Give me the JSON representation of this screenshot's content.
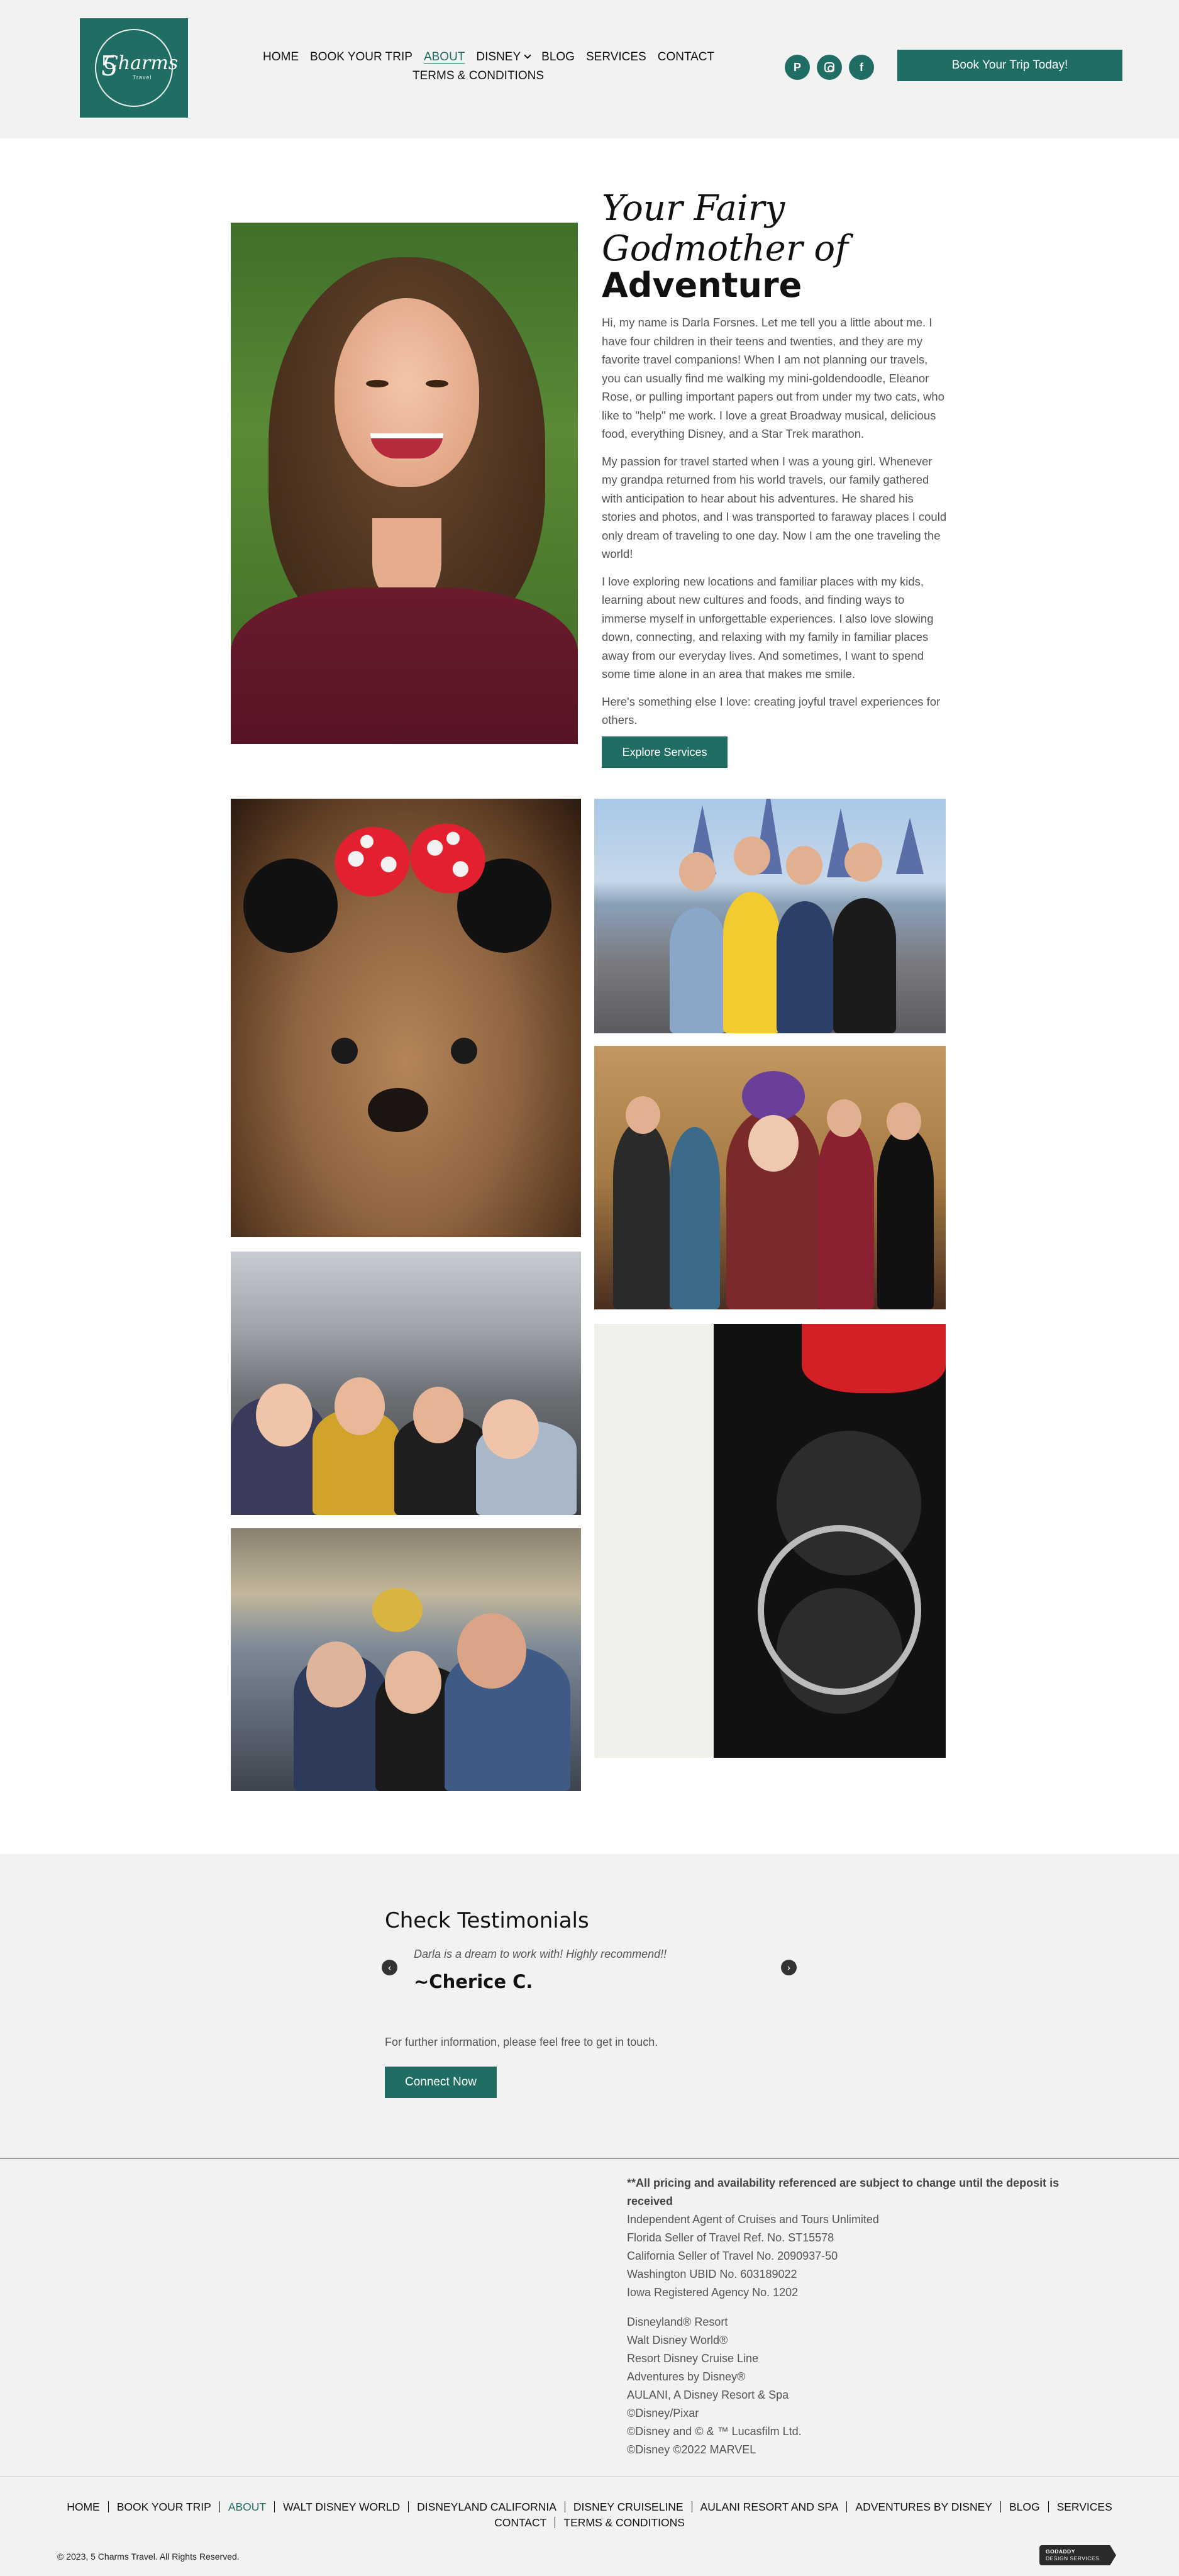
{
  "logo": {
    "number": "5",
    "script": "Charms",
    "sub": "Travel"
  },
  "nav": {
    "items": [
      "HOME",
      "BOOK YOUR TRIP",
      "ABOUT",
      "DISNEY",
      "BLOG",
      "SERVICES",
      "CONTACT"
    ],
    "second_row": "TERMS & CONDITIONS",
    "active": "ABOUT"
  },
  "social": [
    "pinterest-icon",
    "instagram-icon",
    "facebook-icon"
  ],
  "header_button": "Book Your Trip Today!",
  "about": {
    "script_title": "Your Fairy Godmother of",
    "title": "Adventure",
    "paragraphs": [
      "Hi, my name is Darla Forsnes. Let me tell you a little about me. I have four children in their teens and twenties, and they are my favorite travel companions! When I am not planning our travels, you can usually find me walking my mini-goldendoodle, Eleanor Rose, or pulling important papers out from under my two cats, who like to \"help\" me work. I love a great Broadway musical, delicious food, everything Disney, and a Star Trek marathon.",
      "My passion for travel started when I was a young girl. Whenever my grandpa returned from his world travels, our family gathered with anticipation to hear about his adventures. He shared his stories and photos, and I was transported to faraway places I could only dream of traveling to one day. Now I am the one traveling the world!",
      "I love exploring new locations and familiar places with my kids, learning about new cultures and foods, and finding ways to immerse myself in unforgettable experiences. I also love slowing down, connecting, and relaxing with my family in familiar places away from our everyday lives. And sometimes, I want to spend some time alone in an area that makes me smile.",
      "Here's something else I love: creating joyful travel experiences for others."
    ],
    "button": "Explore Services"
  },
  "testimonials": {
    "title": "Check Testimonials",
    "quote": "Darla is a dream to work with! Highly recommend!!",
    "author": "~Cherice C.",
    "prev": "‹",
    "next": "›",
    "further": "For further information, please feel free to get in touch.",
    "button": "Connect Now"
  },
  "legal": {
    "bold": "**All pricing and availability referenced are subject to change until the deposit is received",
    "lines1": [
      "Independent Agent of Cruises and Tours Unlimited",
      "Florida Seller of Travel Ref. No. ST15578",
      "California Seller of Travel No. 2090937-50",
      "Washington UBID No. 603189022",
      "Iowa Registered Agency No. 1202"
    ],
    "lines2": [
      "Disneyland® Resort",
      "Walt Disney World®",
      "Resort Disney Cruise Line",
      "Adventures by Disney®",
      "AULANI, A Disney Resort & Spa",
      "©Disney/Pixar",
      "©Disney and © & ™ Lucasfilm Ltd.",
      "©Disney ©2022 MARVEL"
    ]
  },
  "footer_nav": {
    "row1": [
      "HOME",
      "BOOK YOUR TRIP",
      "ABOUT",
      "WALT DISNEY WORLD",
      "DISNEYLAND CALIFORNIA",
      "DISNEY CRUISELINE",
      "AULANI RESORT AND SPA",
      "ADVENTURES BY DISNEY",
      "BLOG",
      "SERVICES"
    ],
    "row2": [
      "CONTACT",
      "TERMS & CONDITIONS"
    ],
    "active": "ABOUT"
  },
  "copyright": "© 2023, 5 Charms Travel. All Rights Reserved.",
  "badge": {
    "line1": "GODADDY",
    "line2": "DESIGN SERVICES"
  },
  "colors": {
    "brand": "#206e63",
    "header_bg": "#f2f2f2",
    "text": "#555555"
  }
}
